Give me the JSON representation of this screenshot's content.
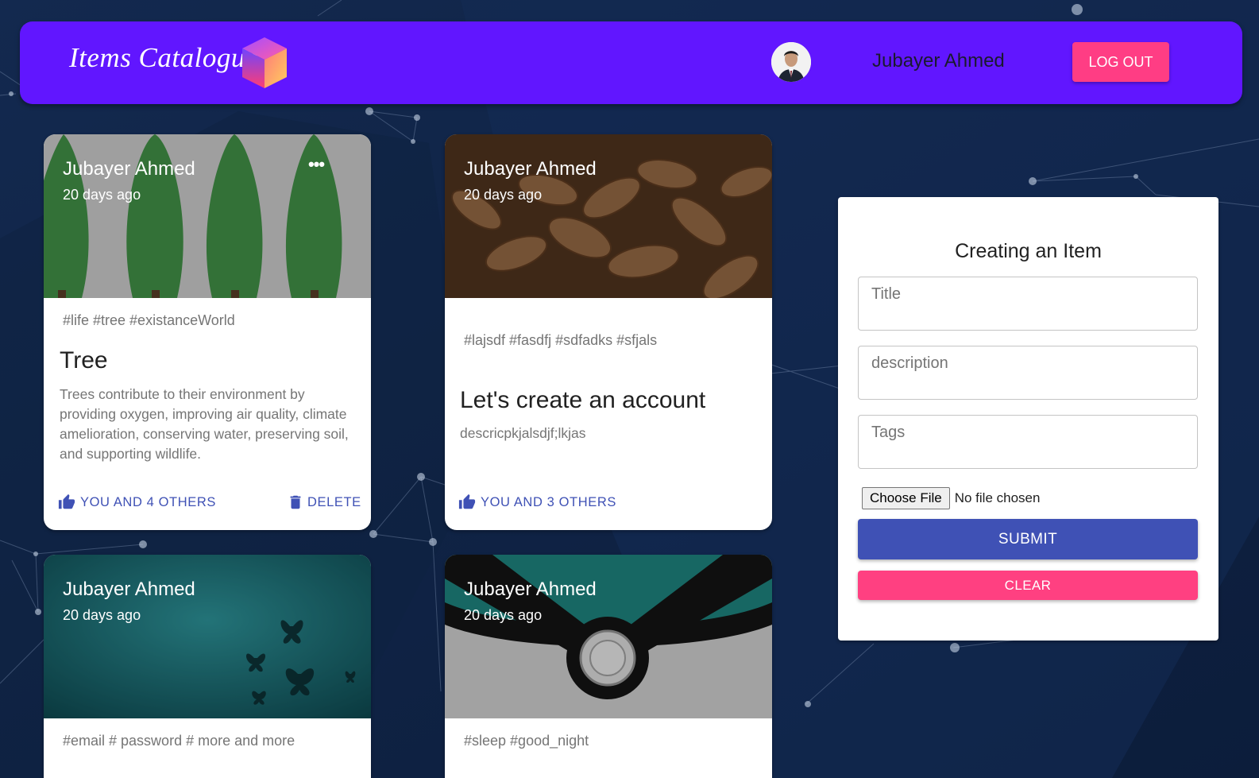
{
  "header": {
    "brand": "Items Catalogue",
    "user_name": "Jubayer Ahmed",
    "logout_label": "LOG OUT"
  },
  "posts": [
    {
      "author": "Jubayer Ahmed",
      "time": "20 days ago",
      "more_label": "•••",
      "tags": "#life #tree #existanceWorld",
      "title": "Tree",
      "description": "Trees contribute to their environment by providing oxygen, improving air quality, climate amelioration, conserving water, preserving soil, and supporting wildlife.",
      "like_label": "YOU AND 4 OTHERS",
      "delete_label": "DELETE"
    },
    {
      "author": "Jubayer Ahmed",
      "time": "20 days ago",
      "tags": "#lajsdf #fasdfj #sdfadks #sfjals",
      "title": "Let's create an account",
      "description": "descricpkjalsdjf;lkjas",
      "like_label": "YOU AND 3 OTHERS"
    },
    {
      "author": "Jubayer Ahmed",
      "time": "20 days ago",
      "tags": "#email # password # more and more"
    },
    {
      "author": "Jubayer Ahmed",
      "time": "20 days ago",
      "tags": "#sleep #good_night"
    }
  ],
  "form": {
    "heading": "Creating an Item",
    "title_placeholder": "Title",
    "description_placeholder": "description",
    "tags_placeholder": "Tags",
    "file_button": "Choose File",
    "file_status": "No file chosen",
    "submit_label": "SUBMIT",
    "clear_label": "CLEAR"
  },
  "colors": {
    "background": "#0f2244",
    "appbar": "#6116ff",
    "primary": "#3f51b5",
    "secondary": "#ff4081"
  },
  "icons": [
    "cube-logo-icon",
    "more-horiz-icon",
    "thumb-up-icon",
    "delete-icon"
  ]
}
